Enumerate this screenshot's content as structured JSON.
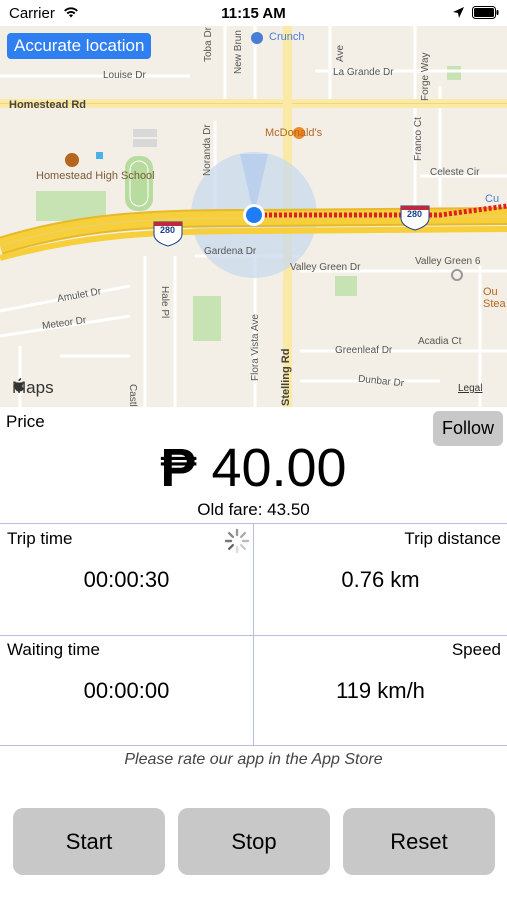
{
  "status_bar": {
    "carrier": "Carrier",
    "time": "11:15 AM"
  },
  "map": {
    "accurate_location_label": "Accurate location",
    "maps_logo": "Maps",
    "legal": "Legal",
    "labels": {
      "louise": "Louise Dr",
      "la_grande": "La Grande Dr",
      "homestead_rd": "Homestead Rd",
      "homestead_school": "Homestead High School",
      "mcdonalds": "McDonald's",
      "crunch": "Crunch",
      "celeste": "Celeste Cir",
      "gardena": "Gardena Dr",
      "valley_green_dr": "Valley Green Dr",
      "valley_green_6": "Valley Green 6",
      "amulet": "Amulet Dr",
      "meteor": "Meteor Dr",
      "greenleaf": "Greenleaf Dr",
      "acadia": "Acadia Ct",
      "dunbar": "Dunbar Dr",
      "stelling": "Stelling Rd",
      "flora_vista": "Flora Vista Ave",
      "noranda": "Noranda Dr",
      "hale": "Hale Pl",
      "franco": "Franco Ct",
      "forge": "Forge Way",
      "new_brun": "New Brun",
      "toba": "Toba Dr",
      "castl": "Castl",
      "ave": "Ave",
      "cu": "Cu",
      "ou_stea": "Ou Stea",
      "hwy_280": "280"
    }
  },
  "price": {
    "title": "Price",
    "follow_label": "Follow",
    "currency": "₱",
    "amount": "40.00",
    "old_fare": "Old fare: 43.50"
  },
  "stats": {
    "trip_time_label": "Trip time",
    "trip_time_value": "00:00:30",
    "trip_distance_label": "Trip distance",
    "trip_distance_value": "0.76 km",
    "waiting_time_label": "Waiting time",
    "waiting_time_value": "00:00:00",
    "speed_label": "Speed",
    "speed_value": "119 km/h"
  },
  "rate_text": "Please rate our app in the App Store",
  "buttons": {
    "start": "Start",
    "stop": "Stop",
    "reset": "Reset"
  },
  "colors": {
    "accent": "#2f7ff0",
    "button_gray": "#c8c8c8",
    "route_red": "#e02020",
    "highway_yellow": "#f7cf3a"
  }
}
